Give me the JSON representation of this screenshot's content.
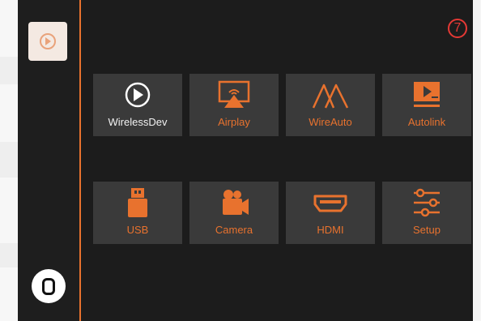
{
  "accent_color": "#e8722e",
  "badge": {
    "text": "7",
    "color": "#e53935"
  },
  "sidebar": {
    "active_app_icon": "play-circle-icon",
    "home_icon": "home-button-icon"
  },
  "tiles": [
    {
      "label": "WirelessDev",
      "icon": "play-circle-icon"
    },
    {
      "label": "Airplay",
      "icon": "airplay-icon"
    },
    {
      "label": "WireAuto",
      "icon": "wireauto-logo-icon"
    },
    {
      "label": "Autolink",
      "icon": "monitor-play-icon"
    },
    {
      "label": "USB",
      "icon": "usb-drive-icon"
    },
    {
      "label": "Camera",
      "icon": "video-camera-icon"
    },
    {
      "label": "HDMI",
      "icon": "hdmi-icon"
    },
    {
      "label": "Setup",
      "icon": "sliders-icon"
    }
  ]
}
